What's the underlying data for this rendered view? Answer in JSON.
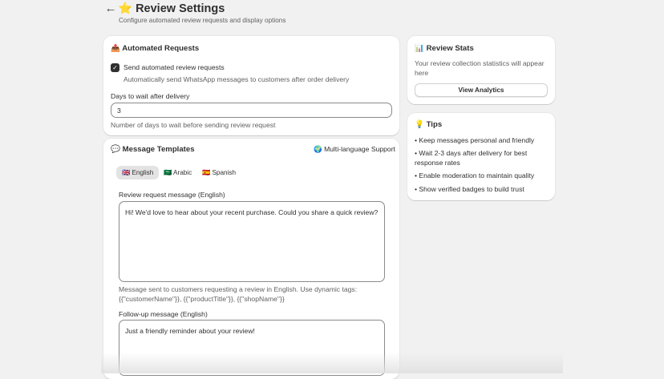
{
  "header": {
    "back_icon": "←",
    "title": "⭐ Review Settings",
    "subtitle": "Configure automated review requests and display options"
  },
  "automated": {
    "title": "📤 Automated Requests",
    "checkbox_label": "Send automated review requests",
    "checkbox_checked": true,
    "checkbox_help": "Automatically send WhatsApp messages to customers after order delivery",
    "days_label": "Days to wait after delivery",
    "days_value": "3",
    "days_help": "Number of days to wait before sending review request"
  },
  "templates": {
    "title": "💬 Message Templates",
    "multilang": "🌍 Multi-language Support",
    "tabs": [
      {
        "label": "🇬🇧 English",
        "active": true
      },
      {
        "label": "🇸🇦 Arabic",
        "active": false
      },
      {
        "label": "🇪🇸 Spanish",
        "active": false
      }
    ],
    "request_label": "Review request message (English)",
    "request_value": "Hi! We'd love to hear about your recent purchase. Could you share a quick review?",
    "request_help": "Message sent to customers requesting a review in English. Use dynamic tags: {{\"customerName\"}}, {{\"productTitle\"}}, {{\"shopName\"}}",
    "followup_label": "Follow-up message (English)",
    "followup_value": "Just a friendly reminder about your review!"
  },
  "stats": {
    "title": "📊 Review Stats",
    "text": "Your review collection statistics will appear here",
    "button": "View Analytics"
  },
  "tips": {
    "title": "💡 Tips",
    "items": [
      "• Keep messages personal and friendly",
      "• Wait 2-3 days after delivery for best response rates",
      "• Enable moderation to maintain quality",
      "• Show verified badges to build trust"
    ]
  }
}
